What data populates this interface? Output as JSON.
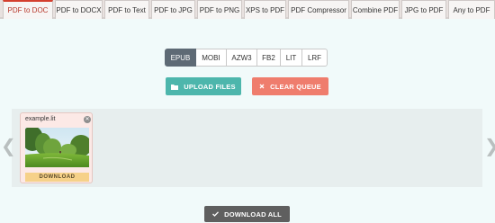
{
  "tabs": [
    {
      "label": "PDF to DOC"
    },
    {
      "label": "PDF to DOCX"
    },
    {
      "label": "PDF to Text"
    },
    {
      "label": "PDF to JPG"
    },
    {
      "label": "PDF to PNG"
    },
    {
      "label": "XPS to PDF"
    },
    {
      "label": "PDF Compressor"
    },
    {
      "label": "Combine PDF"
    },
    {
      "label": "JPG to PDF"
    },
    {
      "label": "Any to PDF"
    }
  ],
  "formats": [
    {
      "label": "EPUB",
      "active": true
    },
    {
      "label": "MOBI",
      "active": false
    },
    {
      "label": "AZW3",
      "active": false
    },
    {
      "label": "FB2",
      "active": false
    },
    {
      "label": "LIT",
      "active": false
    },
    {
      "label": "LRF",
      "active": false
    }
  ],
  "actions": {
    "upload_label": "UPLOAD FILES",
    "upload_icon": "folder-icon",
    "clear_label": "CLEAR QUEUE",
    "clear_icon": "x-icon",
    "download_all_label": "DOWNLOAD ALL",
    "download_all_icon": "check-icon"
  },
  "queue": {
    "items": [
      {
        "filename": "example.lit",
        "download_label": "DOWNLOAD"
      }
    ]
  },
  "colors": {
    "accent_red": "#d43f2f",
    "upload_teal": "#4db6ac",
    "clear_coral": "#ef7d6d",
    "active_format": "#5e6a75",
    "download_yellow": "#f6d189"
  }
}
